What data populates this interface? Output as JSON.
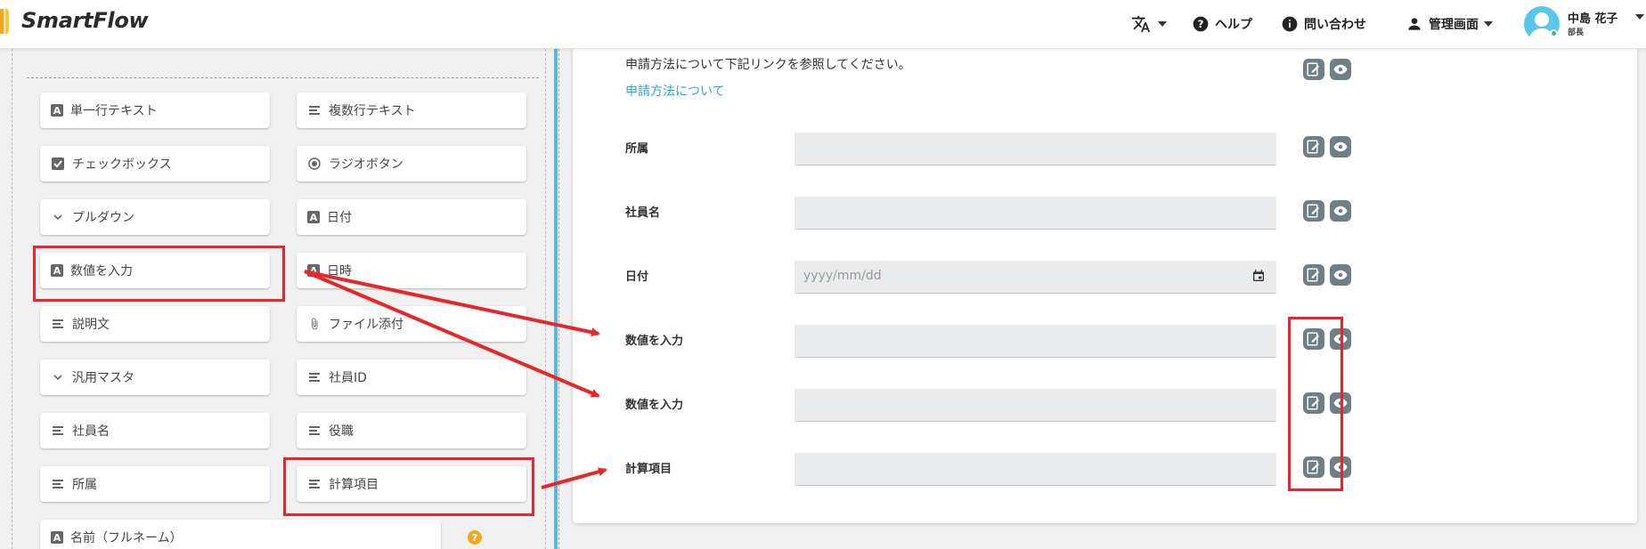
{
  "header": {
    "app_name": "SmartFlow",
    "help": "ヘルプ",
    "contact": "問い合わせ",
    "admin": "管理画面",
    "user_name": "中島 花子",
    "user_role": "部長"
  },
  "palette": {
    "items": [
      {
        "label": "単一行テキスト",
        "icon": "text-a-icon"
      },
      {
        "label": "複数行テキスト",
        "icon": "lines-icon"
      },
      {
        "label": "チェックボックス",
        "icon": "checkbox-icon"
      },
      {
        "label": "ラジオボタン",
        "icon": "radio-icon"
      },
      {
        "label": "プルダウン",
        "icon": "chevron-down-icon"
      },
      {
        "label": "日付",
        "icon": "text-a-icon"
      },
      {
        "label": "数値を入力",
        "icon": "text-a-icon"
      },
      {
        "label": "日時",
        "icon": "text-a-icon"
      },
      {
        "label": "説明文",
        "icon": "lines-icon"
      },
      {
        "label": "ファイル添付",
        "icon": "paperclip-icon"
      },
      {
        "label": "汎用マスタ",
        "icon": "chevron-down-icon"
      },
      {
        "label": "社員ID",
        "icon": "lines-icon"
      },
      {
        "label": "社員名",
        "icon": "lines-icon"
      },
      {
        "label": "役職",
        "icon": "lines-icon"
      },
      {
        "label": "所属",
        "icon": "lines-icon"
      },
      {
        "label": "計算項目",
        "icon": "lines-icon"
      },
      {
        "label": "名前（フルネーム）",
        "icon": "text-a-icon"
      }
    ]
  },
  "form": {
    "description": "申請方法について下記リンクを参照してください。",
    "link": "申請方法について",
    "fields": [
      {
        "label": "所属",
        "placeholder": ""
      },
      {
        "label": "社員名",
        "placeholder": ""
      },
      {
        "label": "日付",
        "placeholder": "yyyy/mm/dd"
      },
      {
        "label": "数値を入力",
        "placeholder": ""
      },
      {
        "label": "数値を入力",
        "placeholder": ""
      },
      {
        "label": "計算項目",
        "placeholder": ""
      }
    ]
  },
  "colors": {
    "accent": "#2fa6d9",
    "annotation": "#e8262a",
    "action_button": "#6f7f88"
  }
}
